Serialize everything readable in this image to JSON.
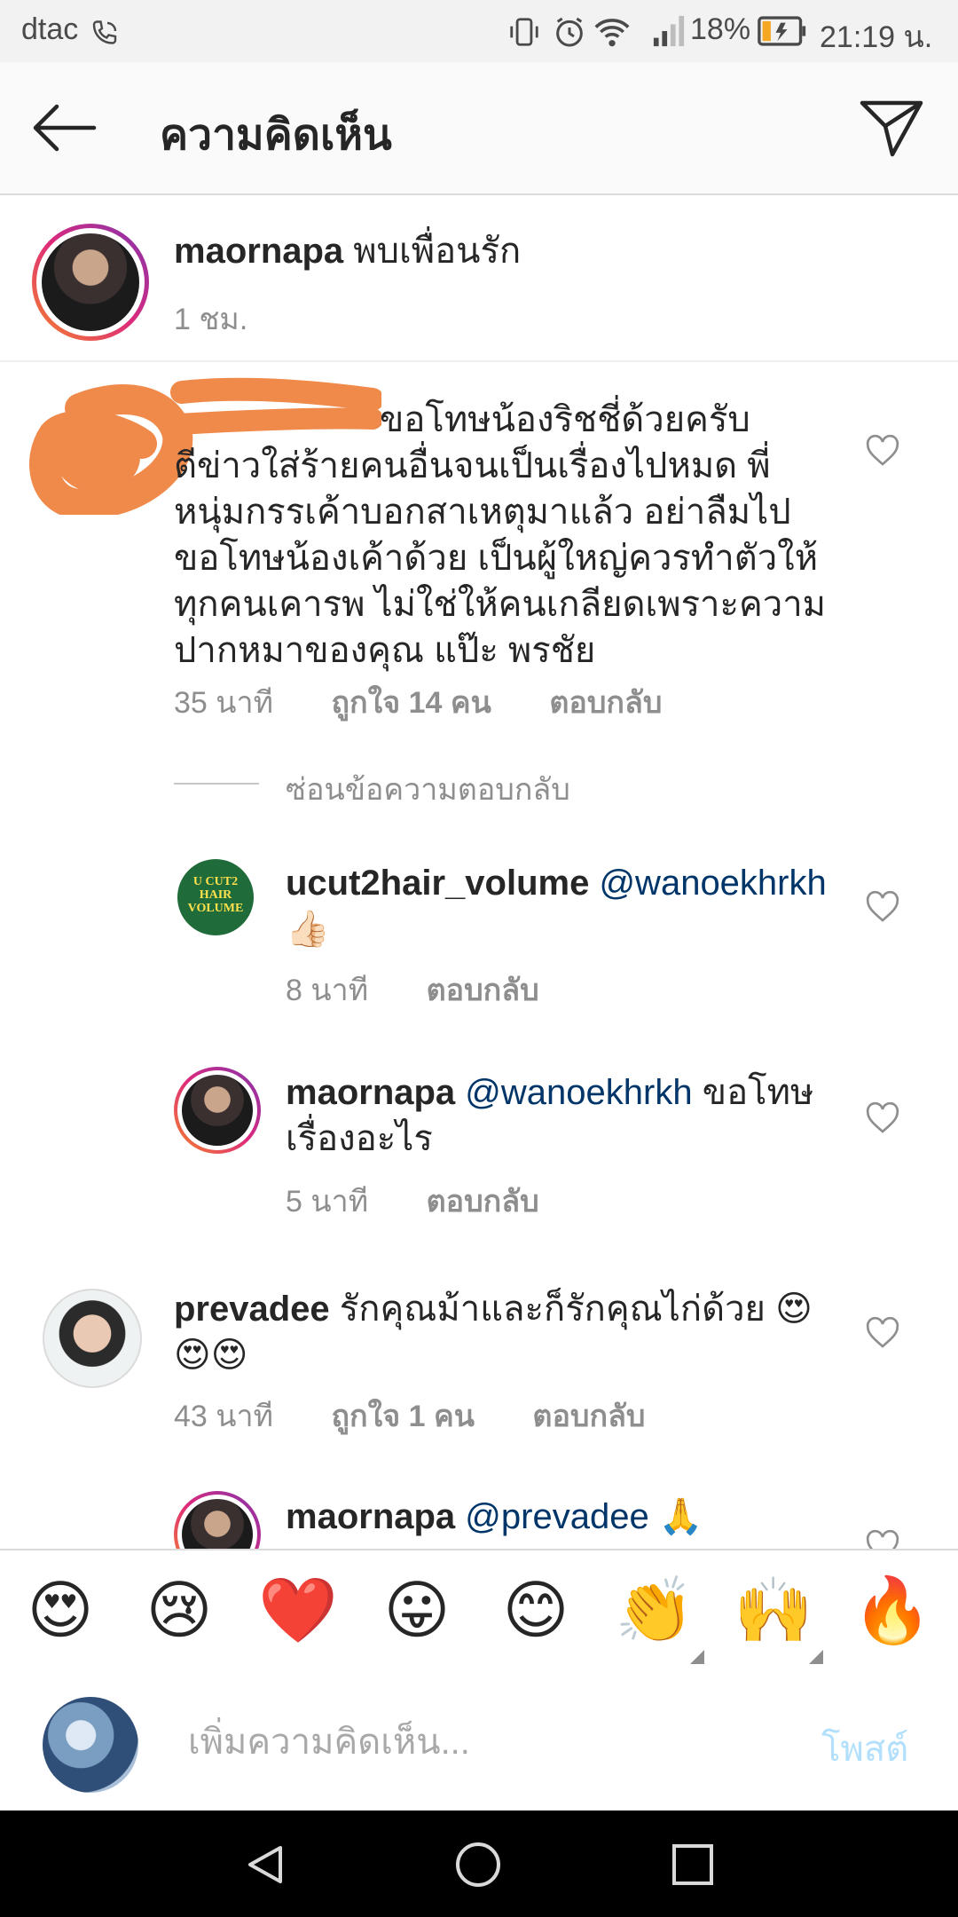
{
  "status_bar": {
    "carrier": "dtac",
    "battery": "18%",
    "time": "21:19 น."
  },
  "header": {
    "title": "ความคิดเห็น"
  },
  "caption": {
    "username": "maornapa",
    "text": "พบเพื่อนรัก",
    "time": "1 ชม."
  },
  "comments": [
    {
      "username": "",
      "lines": [
        "ขอโทษน้องริชชี่ด้วยครับ",
        "ตีข่าวใส่ร้ายคนอื่นจนเป็นเรื่องไปหมด พี่",
        "หนุ่มกรรเค้าบอกสาเหตุมาแล้ว อย่าลืมไป",
        "ขอโทษน้องเค้าด้วย เป็นผู้ใหญ่ควรทำตัวให้",
        "ทุกคนเคารพ ไม่ใช่ให้คนเกลียดเพราะความ",
        "ปากหมาของคุณ แป๊ะ พรชัย"
      ],
      "time": "35 นาที",
      "likes": "ถูกใจ 14 คน",
      "reply": "ตอบกลับ",
      "hide_replies": "ซ่อนข้อความตอบกลับ",
      "replies": [
        {
          "username": "ucut2hair_volume",
          "mention": "@wanoekhrkh",
          "text": "👍🏻",
          "time": "8 นาที",
          "reply": "ตอบกลับ",
          "avatar_label": "U CUT2 HAIR VOLUME"
        },
        {
          "username": "maornapa",
          "mention": "@wanoekhrkh",
          "text": "ขอโทษ",
          "text2": "เรื่องอะไร",
          "time": "5 นาที",
          "reply": "ตอบกลับ"
        }
      ]
    },
    {
      "username": "prevadee",
      "text": "รักคุณม้าและก็รักคุณไก่ด้วย 😍",
      "text2": "😍😍",
      "time": "43 นาที",
      "likes": "ถูกใจ 1 คน",
      "reply": "ตอบกลับ",
      "replies": [
        {
          "username": "maornapa",
          "mention": "@prevadee",
          "text": "🙏"
        }
      ]
    }
  ],
  "emoji_bar": [
    "😍",
    "😢",
    "❤️",
    "😛",
    "😊",
    "👏",
    "🙌",
    "🔥"
  ],
  "composer": {
    "placeholder": "เพิ่มความคิดเห็น...",
    "post_label": "โพสต์"
  },
  "colors": {
    "text": "#262626",
    "meta": "#8e8e8e",
    "mention": "#003569",
    "post_disabled": "#b2dffc",
    "redaction": "#f08a4b"
  }
}
